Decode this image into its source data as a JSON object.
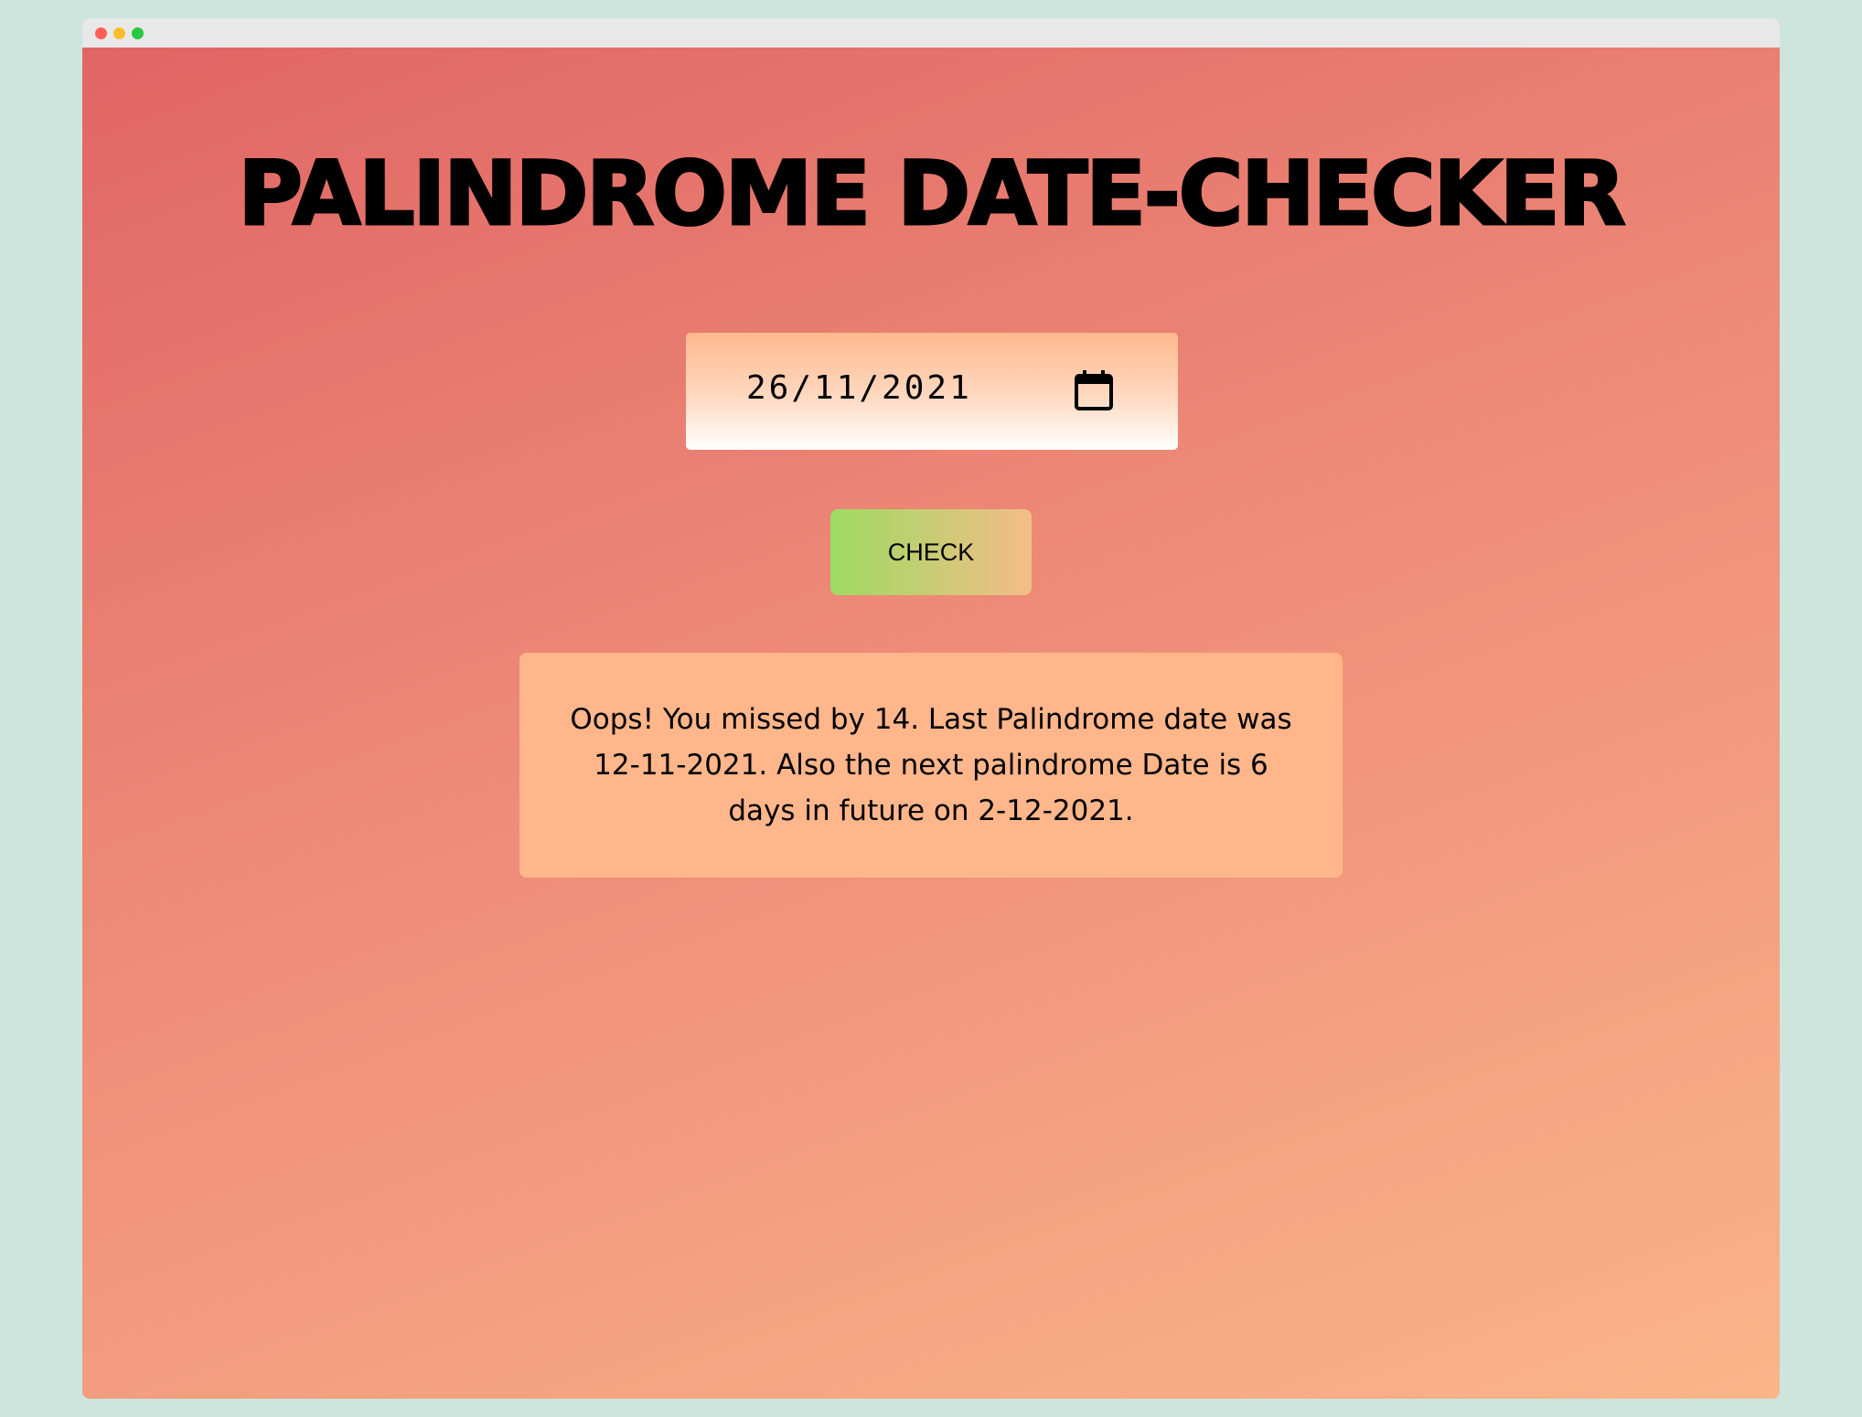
{
  "app": {
    "title": "PALINDROME DATE-CHECKER"
  },
  "date_input": {
    "value": "26/11/2021",
    "icon": "calendar-icon"
  },
  "check_button": {
    "label": "CHECK"
  },
  "result": {
    "message": "Oops! You missed by 14. Last Palindrome date was 12-11-2021. Also the next palindrome Date is 6 days in future on 2-12-2021."
  },
  "colors": {
    "page_background": "#cde5dc",
    "gradient_start": "#e06464",
    "gradient_end": "#fbb48a",
    "result_box": "#ffb68b",
    "button_gradient_start": "#9edb62",
    "button_gradient_end": "#f3bd87"
  }
}
